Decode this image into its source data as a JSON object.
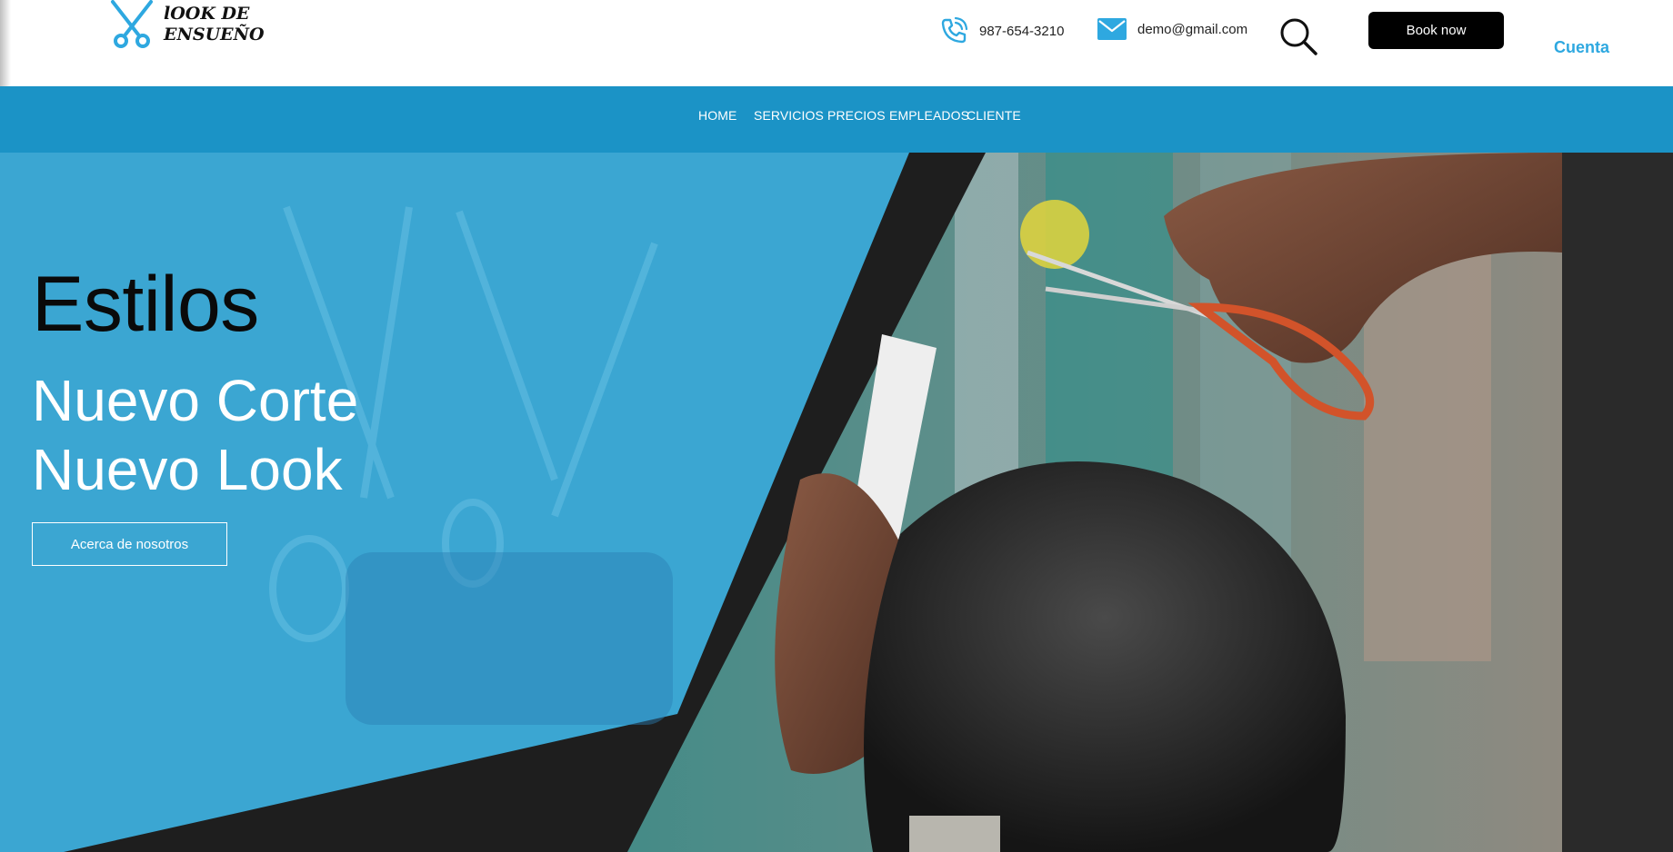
{
  "brand": {
    "name_line1": "lOOK DE",
    "name_line2": "ENSUEÑO",
    "icon": "scissors-icon",
    "accent_color": "#2ea8e0"
  },
  "header": {
    "phone": "987-654-3210",
    "email": "demo@gmail.com",
    "book_label": "Book now",
    "account_label": "Cuenta"
  },
  "nav": {
    "items": [
      "HOME",
      "SERVICIOS",
      "PRECIOS",
      "EMPLEADOS",
      "CLIENTE"
    ],
    "background": "#1b93c6"
  },
  "hero": {
    "title": "Estilos",
    "line1": "Nuevo Corte",
    "line2": "Nuevo Look",
    "cta_label": "Acerca de nosotros",
    "panel_color": "#3db0e0"
  }
}
